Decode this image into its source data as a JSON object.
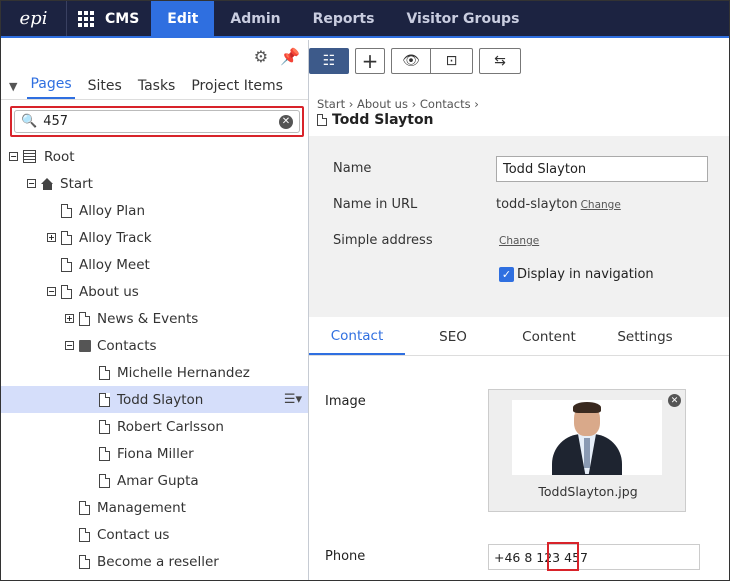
{
  "topnav": {
    "logo": "epi",
    "app": "CMS",
    "tabs": [
      {
        "label": "Edit",
        "active": true
      },
      {
        "label": "Admin"
      },
      {
        "label": "Reports"
      },
      {
        "label": "Visitor Groups"
      }
    ]
  },
  "left": {
    "tabs": [
      "Pages",
      "Sites",
      "Tasks",
      "Project Items"
    ],
    "active_tab": "Pages",
    "search": {
      "value": "457"
    },
    "tree": [
      {
        "label": "Root",
        "depth": 0,
        "toggle": "−",
        "icon": "root"
      },
      {
        "label": "Start",
        "depth": 1,
        "toggle": "−",
        "icon": "home"
      },
      {
        "label": "Alloy Plan",
        "depth": 2,
        "toggle": "",
        "icon": "page"
      },
      {
        "label": "Alloy Track",
        "depth": 2,
        "toggle": "+",
        "icon": "page"
      },
      {
        "label": "Alloy Meet",
        "depth": 2,
        "toggle": "",
        "icon": "page"
      },
      {
        "label": "About us",
        "depth": 2,
        "toggle": "−",
        "icon": "page"
      },
      {
        "label": "News & Events",
        "depth": 3,
        "toggle": "+",
        "icon": "page"
      },
      {
        "label": "Contacts",
        "depth": 3,
        "toggle": "−",
        "icon": "folder"
      },
      {
        "label": "Michelle Hernandez",
        "depth": 4,
        "toggle": "",
        "icon": "page"
      },
      {
        "label": "Todd Slayton",
        "depth": 4,
        "toggle": "",
        "icon": "page",
        "selected": true
      },
      {
        "label": "Robert Carlsson",
        "depth": 4,
        "toggle": "",
        "icon": "page"
      },
      {
        "label": "Fiona Miller",
        "depth": 4,
        "toggle": "",
        "icon": "page"
      },
      {
        "label": "Amar Gupta",
        "depth": 4,
        "toggle": "",
        "icon": "page"
      },
      {
        "label": "Management",
        "depth": 3,
        "toggle": "",
        "icon": "page"
      },
      {
        "label": "Contact us",
        "depth": 3,
        "toggle": "",
        "icon": "page"
      },
      {
        "label": "Become a reseller",
        "depth": 3,
        "toggle": "",
        "icon": "page"
      }
    ]
  },
  "right": {
    "breadcrumb": [
      "Start",
      "About us",
      "Contacts"
    ],
    "title": "Todd Slayton",
    "props": {
      "name_label": "Name",
      "name_value": "Todd Slayton",
      "url_label": "Name in URL",
      "url_value": "todd-slayton",
      "change": "Change",
      "address_label": "Simple address",
      "nav_label": "Display in navigation"
    },
    "tabs": [
      "Contact",
      "SEO",
      "Content",
      "Settings"
    ],
    "active_tab": "Contact",
    "image_label": "Image",
    "image_file": "TodPlaceholder",
    "phone_label": "Phone",
    "phone_value": "+46 8 123 457"
  },
  "colors": {
    "nav_bg": "#1c2341",
    "accent": "#2f6fe0",
    "highlight": "#d8232a"
  }
}
